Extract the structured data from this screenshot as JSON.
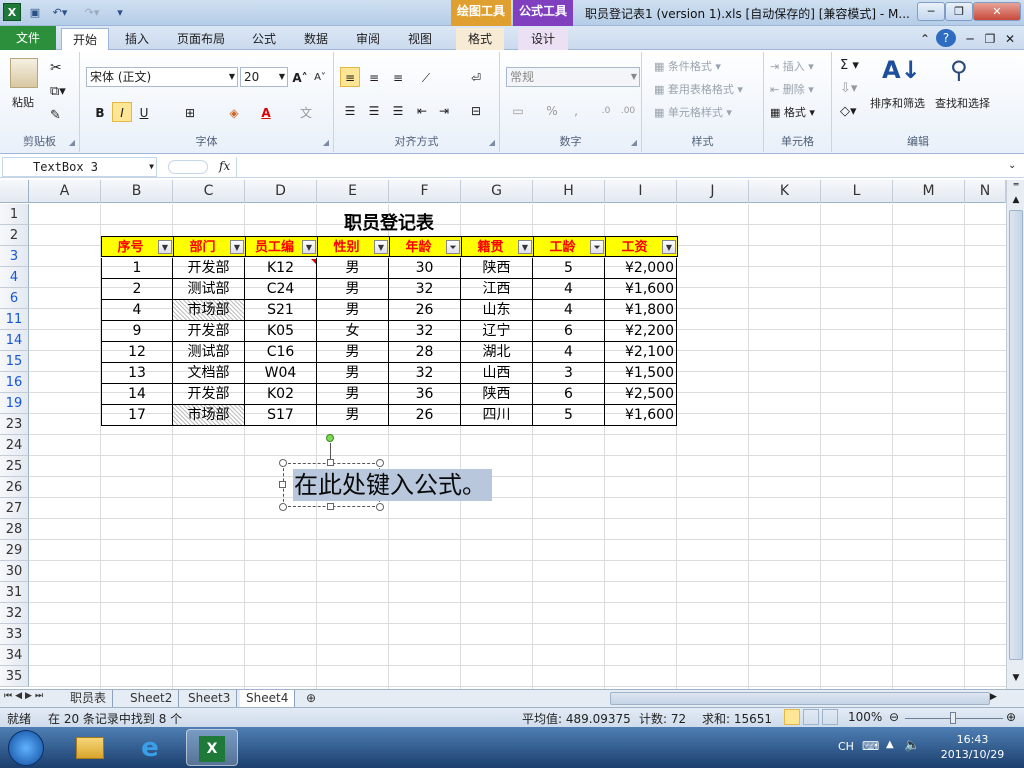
{
  "titlebar": {
    "ctx_tab_draw": "绘图工具",
    "ctx_tab_formula": "公式工具",
    "doc_title": "职员登记表1 (version 1).xls [自动保存的]  [兼容模式] - M...",
    "logo": "X"
  },
  "tabs": [
    "文件",
    "开始",
    "插入",
    "页面布局",
    "公式",
    "数据",
    "审阅",
    "视图",
    "格式",
    "设计"
  ],
  "ribbon": {
    "clipboard": {
      "label": "剪贴板",
      "paste": "粘贴"
    },
    "font": {
      "label": "字体",
      "name": "宋体 (正文)",
      "size": "20",
      "bold": "B",
      "italic": "I",
      "underline": "U"
    },
    "align": {
      "label": "对齐方式"
    },
    "number": {
      "label": "数字",
      "format": "常规",
      "percent": "%",
      "comma": ","
    },
    "styles": {
      "label": "样式",
      "cond": "条件格式",
      "table": "套用表格格式",
      "cell": "单元格样式"
    },
    "cells": {
      "label": "单元格",
      "insert": "插入",
      "delete": "删除",
      "format": "格式"
    },
    "editing": {
      "label": "编辑",
      "sort": "排序和筛选",
      "find": "查找和选择",
      "sigma": "Σ"
    }
  },
  "formula_bar": {
    "name_box": "TextBox 3",
    "fx": "fx",
    "value": ""
  },
  "columns": [
    "A",
    "B",
    "C",
    "D",
    "E",
    "F",
    "G",
    "H",
    "I",
    "J",
    "K",
    "L",
    "M",
    "N"
  ],
  "rows": [
    "1",
    "2",
    "3",
    "4",
    "6",
    "11",
    "14",
    "15",
    "16",
    "19",
    "23",
    "24",
    "25",
    "26",
    "27",
    "28",
    "29",
    "30",
    "31",
    "32",
    "33",
    "34",
    "35"
  ],
  "sheet": {
    "title": "职员登记表",
    "headers": [
      "序号",
      "部门",
      "员工编号",
      "性别",
      "年龄",
      "籍贯",
      "工龄",
      "工资"
    ],
    "header_display": [
      "序号",
      "部门",
      "员工编",
      "性别",
      "年龄",
      "籍贯",
      "工龄",
      "工资"
    ],
    "data": [
      [
        "1",
        "开发部",
        "K12",
        "男",
        "30",
        "陕西",
        "5",
        "¥2,000"
      ],
      [
        "2",
        "测试部",
        "C24",
        "男",
        "32",
        "江西",
        "4",
        "¥1,600"
      ],
      [
        "4",
        "市场部",
        "S21",
        "男",
        "26",
        "山东",
        "4",
        "¥1,800"
      ],
      [
        "9",
        "开发部",
        "K05",
        "女",
        "32",
        "辽宁",
        "6",
        "¥2,200"
      ],
      [
        "12",
        "测试部",
        "C16",
        "男",
        "28",
        "湖北",
        "4",
        "¥2,100"
      ],
      [
        "13",
        "文档部",
        "W04",
        "男",
        "32",
        "山西",
        "3",
        "¥1,500"
      ],
      [
        "14",
        "开发部",
        "K02",
        "男",
        "36",
        "陕西",
        "6",
        "¥2,500"
      ],
      [
        "17",
        "市场部",
        "S17",
        "男",
        "26",
        "四川",
        "5",
        "¥1,600"
      ]
    ]
  },
  "textbox": {
    "text": "在此处键入公式。"
  },
  "sheet_tabs": [
    "职员表",
    "Sheet2",
    "Sheet3",
    "Sheet4"
  ],
  "status": {
    "ready": "就绪",
    "found": "在 20 条记录中找到 8 个",
    "average": "平均值: 489.09375",
    "count": "计数: 72",
    "sum": "求和: 15651",
    "zoom": "100%"
  },
  "taskbar": {
    "lang": "CH",
    "time": "16:43",
    "date": "2013/10/29"
  },
  "colors": {
    "header_fill": "#ffff00",
    "header_text": "#ff0000",
    "file_tab": "#2c8f3b",
    "ctx_draw": "#e0a030",
    "ctx_formula": "#7f3fbf"
  }
}
